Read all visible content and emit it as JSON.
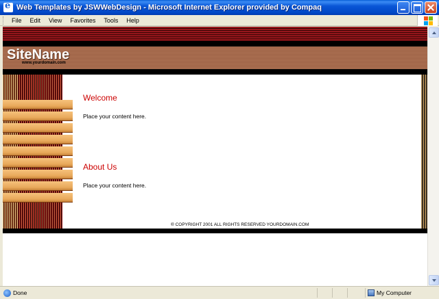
{
  "window": {
    "title": "Web Templates by JSWWebDesign - Microsoft Internet Explorer provided by Compaq"
  },
  "menu": {
    "items": [
      "File",
      "Edit",
      "View",
      "Favorites",
      "Tools",
      "Help"
    ]
  },
  "page": {
    "site_name": "SiteName",
    "site_url": "www.yourdomain.com",
    "nav_button_count": 9,
    "sections": [
      {
        "title": "Welcome",
        "body": "Place your content here."
      },
      {
        "title": "About Us",
        "body": "Place your content here."
      }
    ],
    "copyright": "® COPYRIGHT 2001 ALL RIGHTS RESERVED YOURDOMAIN.COM"
  },
  "status": {
    "text": "Done",
    "zone": "My Computer"
  },
  "colors": {
    "title_bar": "#0a56d6",
    "header_brown": "#a86a4c",
    "stripe_red": "#c0202a",
    "nav_orange": "#e8a85a",
    "heading_red": "#cc0000"
  }
}
